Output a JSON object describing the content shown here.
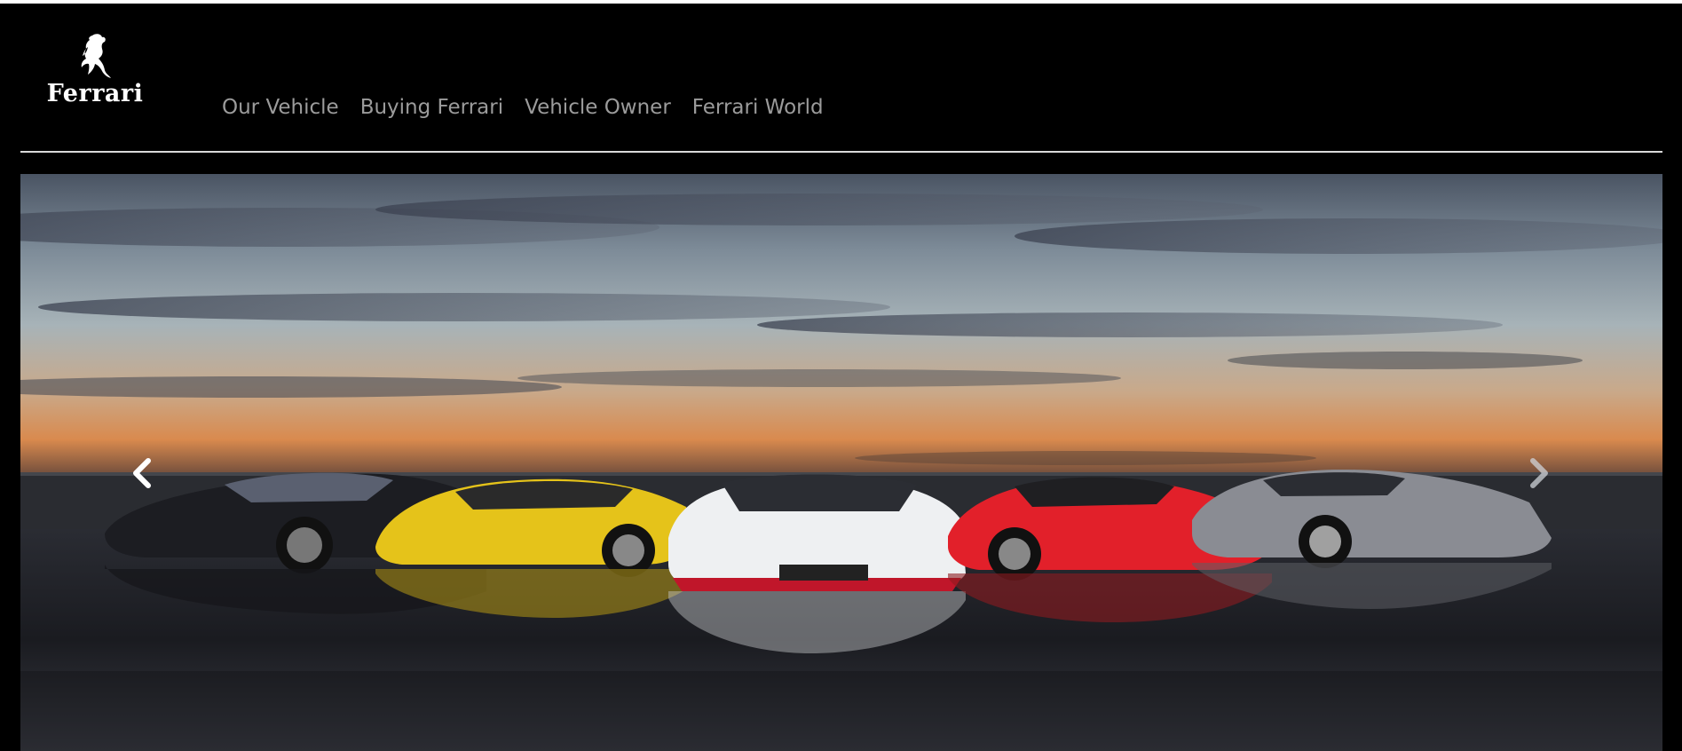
{
  "brand": {
    "name": "Ferrari",
    "logo_icon": "prancing-horse-icon"
  },
  "nav": {
    "items": [
      {
        "label": "Our Vehicle"
      },
      {
        "label": "Buying Ferrari"
      },
      {
        "label": "Vehicle Owner"
      },
      {
        "label": "Ferrari World"
      }
    ]
  },
  "carousel": {
    "prev_icon": "chevron-left-icon",
    "next_icon": "chevron-right-icon",
    "slide_image": "five supercars lined up on a wet rooftop at sunset"
  },
  "colors": {
    "background": "#000000",
    "nav_text": "#9b9b9b",
    "divider": "#d9d9d9"
  }
}
